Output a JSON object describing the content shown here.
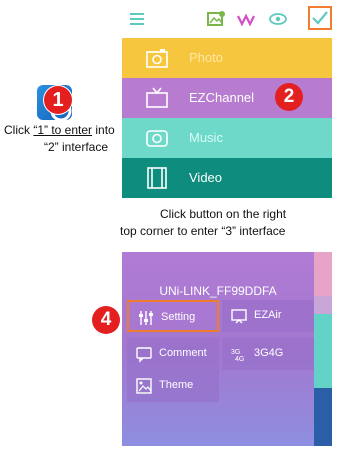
{
  "instruction": {
    "click_prefix": "Click ",
    "underlined": "“1” to enter",
    "click_suffix": " into",
    "line2": "“2” interface"
  },
  "badges": {
    "one": "1",
    "two": "2",
    "four": "4"
  },
  "topbar": {
    "icons": [
      "menu-icon",
      "add-photo-icon",
      "wave-icon",
      "eye-icon",
      "checkmark-icon"
    ]
  },
  "menu": {
    "items": [
      {
        "label": "Photo",
        "icon": "camera-icon",
        "color": "#f7c63f"
      },
      {
        "label": "EZChannel",
        "icon": "tv-icon",
        "color": "#b77bd0"
      },
      {
        "label": "Music",
        "icon": "speaker-icon",
        "color": "#6fd9c9"
      },
      {
        "label": "Video",
        "icon": "film-icon",
        "color": "#0e8d7e"
      }
    ]
  },
  "caption": {
    "line1": "Click button  on the right",
    "line2": "top corner to enter  “3” interface"
  },
  "settings_panel": {
    "device_name": "UNi-LINK_FF99DDFA",
    "items": [
      {
        "label": "Setting",
        "icon": "sliders-icon"
      },
      {
        "label": "EZAir",
        "icon": "cast-icon"
      },
      {
        "label": "Comment",
        "icon": "comment-icon"
      },
      {
        "label": "3G4G",
        "icon": "network-icon"
      },
      {
        "label": "Theme",
        "icon": "image-icon"
      }
    ]
  },
  "colors": {
    "highlight": "#f07c2e",
    "badge": "#e41f1f"
  }
}
